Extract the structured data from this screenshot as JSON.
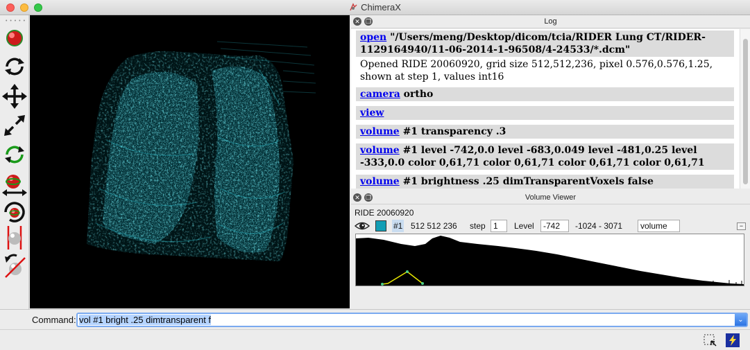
{
  "window": {
    "title": "ChimeraX"
  },
  "colors": {
    "volume": "#2fd8e8",
    "accent": "#3b82f6",
    "link": "#0000ee"
  },
  "toolbar": {
    "icons": [
      "red-ball-icon",
      "rotate-icon",
      "translate-icon",
      "zoom-icon",
      "rotate-selected-icon",
      "translate-selected-icon",
      "pivot-icon",
      "clip-icon",
      "clip-rotate-icon"
    ]
  },
  "log": {
    "title": "Log",
    "entries": [
      {
        "cmd": "open",
        "args": "\"/Users/meng/Desktop/dicom/tcia/RIDER Lung CT/RIDER-1129164940/11-06-2014-1-96508/4-24533/*.dcm\"",
        "message": "Opened RIDE 20060920, grid size 512,512,236, pixel 0.576,0.576,1.25, shown at step 1, values int16"
      },
      {
        "cmd": "camera",
        "args": "ortho"
      },
      {
        "cmd": "view",
        "args": ""
      },
      {
        "cmd": "volume",
        "args": "#1 transparency .3"
      },
      {
        "cmd": "volume",
        "args": "#1 level -742,0.0 level -683,0.049 level -481,0.25 level -333,0.0 color 0,61,71 color 0,61,71 color 0,61,71 color 0,61,71"
      },
      {
        "cmd": "volume",
        "args": "#1 brightness .25 dimTransparentVoxels false"
      }
    ]
  },
  "volume_viewer": {
    "title": "Volume Viewer",
    "name": "RIDE  20060920",
    "model_id": "#1",
    "size": "512 512 236",
    "step_label": "step",
    "step": "1",
    "level_label": "Level",
    "level": "-742",
    "range": "-1024 - 3071",
    "style": "volume"
  },
  "command": {
    "label": "Command:",
    "value": "vol #1 bright .25 dimtransparent f"
  }
}
